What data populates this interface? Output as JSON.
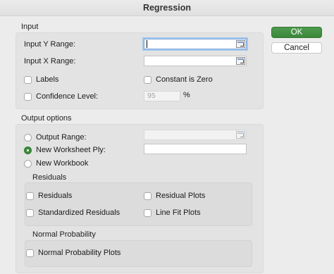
{
  "dialog": {
    "title": "Regression"
  },
  "buttons": {
    "ok": "OK",
    "cancel": "Cancel"
  },
  "input": {
    "section": "Input",
    "y_range_label": "Input Y Range:",
    "y_range_value": "",
    "x_range_label": "Input X Range:",
    "x_range_value": "",
    "labels": {
      "label": "Labels",
      "checked": false
    },
    "constant_zero": {
      "label": "Constant is Zero",
      "checked": false
    },
    "confidence": {
      "label": "Confidence Level:",
      "checked": false,
      "value": "95",
      "unit": "%"
    }
  },
  "output": {
    "section": "Output options",
    "output_range": {
      "label": "Output Range:",
      "selected": false,
      "value": ""
    },
    "new_worksheet": {
      "label": "New Worksheet Ply:",
      "selected": true,
      "value": ""
    },
    "new_workbook": {
      "label": "New Workbook",
      "selected": false
    }
  },
  "residuals": {
    "section": "Residuals",
    "residuals": {
      "label": "Residuals",
      "checked": false
    },
    "residual_plots": {
      "label": "Residual Plots",
      "checked": false
    },
    "standardized": {
      "label": "Standardized Residuals",
      "checked": false
    },
    "line_fit": {
      "label": "Line Fit Plots",
      "checked": false
    }
  },
  "normal_probability": {
    "section": "Normal Probability",
    "plots": {
      "label": "Normal Probability Plots",
      "checked": false
    }
  },
  "colors": {
    "accent": "#3d8b3d",
    "background": "#ececec",
    "group": "#e3e3e3"
  }
}
